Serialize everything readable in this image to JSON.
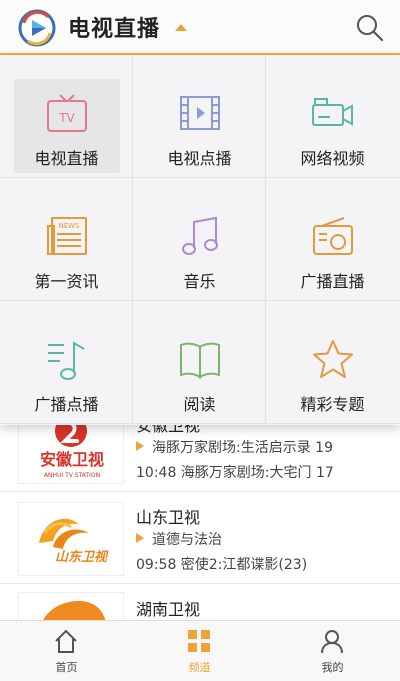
{
  "header": {
    "title": "电视直播"
  },
  "menu": {
    "items": [
      {
        "label": "电视直播",
        "icon": "tv-icon",
        "selected": true
      },
      {
        "label": "电视点播",
        "icon": "film-icon"
      },
      {
        "label": "网络视频",
        "icon": "video-camera-icon"
      },
      {
        "label": "第一资讯",
        "icon": "news-icon",
        "badge": "NEWS"
      },
      {
        "label": "音乐",
        "icon": "music-note-icon"
      },
      {
        "label": "广播直播",
        "icon": "radio-icon"
      },
      {
        "label": "广播点播",
        "icon": "audio-playlist-icon"
      },
      {
        "label": "阅读",
        "icon": "book-icon"
      },
      {
        "label": "精彩专题",
        "icon": "star-icon"
      }
    ]
  },
  "channels": [
    {
      "name": "安徽卫视",
      "logo_text": "安徽卫视",
      "logo_subtext": "ANHUI TV STATION",
      "now": "海豚万家剧场:生活启示录 19",
      "next": "10:48 海豚万家剧场:大宅门 17"
    },
    {
      "name": "山东卫视",
      "logo_text": "山东卫视",
      "now": "道德与法治",
      "next": "09:58 密使2:江都谍影(23)"
    },
    {
      "name": "湖南卫视"
    }
  ],
  "tabbar": {
    "items": [
      {
        "label": "首页",
        "icon": "home-icon"
      },
      {
        "label": "频道",
        "icon": "grid-icon",
        "active": true
      },
      {
        "label": "我的",
        "icon": "user-icon"
      }
    ]
  },
  "colors": {
    "accent": "#f0a23a",
    "icon_red": "#e27a8c",
    "icon_blue": "#8c9ad8",
    "icon_teal": "#5bb6a6",
    "icon_purple": "#a98bd2",
    "icon_orange": "#e29a3a",
    "icon_green": "#7cb46a"
  }
}
